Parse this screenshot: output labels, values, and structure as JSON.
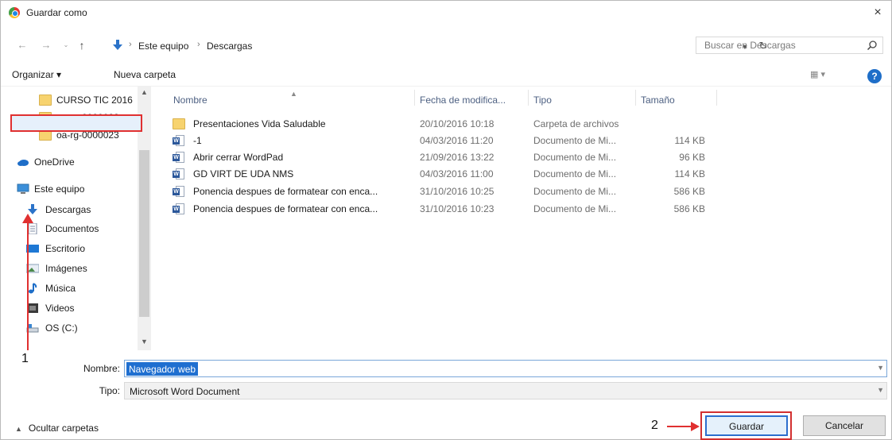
{
  "window": {
    "title": "Guardar como",
    "close": "×"
  },
  "address": {
    "crumbs": [
      "Este equipo",
      "Descargas"
    ],
    "separator": "›",
    "search_placeholder": "Buscar en Descargas"
  },
  "toolbar": {
    "organize": "Organizar ▾",
    "new_folder": "Nueva carpeta",
    "help": "?"
  },
  "nav_pane": {
    "items": [
      {
        "label": "CURSO TIC 2016",
        "icon": "folder-icon"
      },
      {
        "label": "oa-rg-0000022",
        "icon": "folder-icon"
      },
      {
        "label": "oa-rg-0000023",
        "icon": "folder-icon"
      },
      {
        "label": "OneDrive",
        "icon": "cloud-icon"
      },
      {
        "label": "Este equipo",
        "icon": "computer-icon"
      },
      {
        "label": "Descargas",
        "icon": "download-icon",
        "selected": true
      },
      {
        "label": "Documentos",
        "icon": "document-icon"
      },
      {
        "label": "Escritorio",
        "icon": "desktop-icon"
      },
      {
        "label": "Imágenes",
        "icon": "pictures-icon"
      },
      {
        "label": "Música",
        "icon": "music-icon"
      },
      {
        "label": "Videos",
        "icon": "video-icon"
      },
      {
        "label": "OS (C:)",
        "icon": "drive-icon"
      }
    ]
  },
  "columns": {
    "name": "Nombre",
    "date": "Fecha de modifica...",
    "type": "Tipo",
    "size": "Tamaño"
  },
  "files": [
    {
      "name": "Presentaciones Vida Saludable",
      "date": "20/10/2016 10:18",
      "type": "Carpeta de archivos",
      "size": "",
      "icon": "folder-icon"
    },
    {
      "name": "-1",
      "date": "04/03/2016 11:20",
      "type": "Documento de Mi...",
      "size": "114 KB",
      "icon": "word-doc-icon"
    },
    {
      "name": "Abrir cerrar WordPad",
      "date": "21/09/2016 13:22",
      "type": "Documento de Mi...",
      "size": "96 KB",
      "icon": "word-doc-icon"
    },
    {
      "name": "GD VIRT DE UDA NMS",
      "date": "04/03/2016 11:00",
      "type": "Documento de Mi...",
      "size": "114 KB",
      "icon": "word-doc-icon"
    },
    {
      "name": "Ponencia despues de formatear con enca...",
      "date": "31/10/2016 10:25",
      "type": "Documento de Mi...",
      "size": "586 KB",
      "icon": "word-doc-icon"
    },
    {
      "name": "Ponencia despues de formatear con enca...",
      "date": "31/10/2016 10:23",
      "type": "Documento de Mi...",
      "size": "586 KB",
      "icon": "word-doc-icon"
    }
  ],
  "form": {
    "name_label": "Nombre:",
    "name_value": "Navegador web",
    "type_label": "Tipo:",
    "type_value": "Microsoft Word Document"
  },
  "footer": {
    "hide_folders": "Ocultar carpetas",
    "save": "Guardar",
    "cancel": "Cancelar"
  },
  "annotations": {
    "one": "1",
    "two": "2"
  },
  "colors": {
    "accent": "#1f6fd0",
    "annotation": "#e03030",
    "folder": "#f7d36f"
  }
}
